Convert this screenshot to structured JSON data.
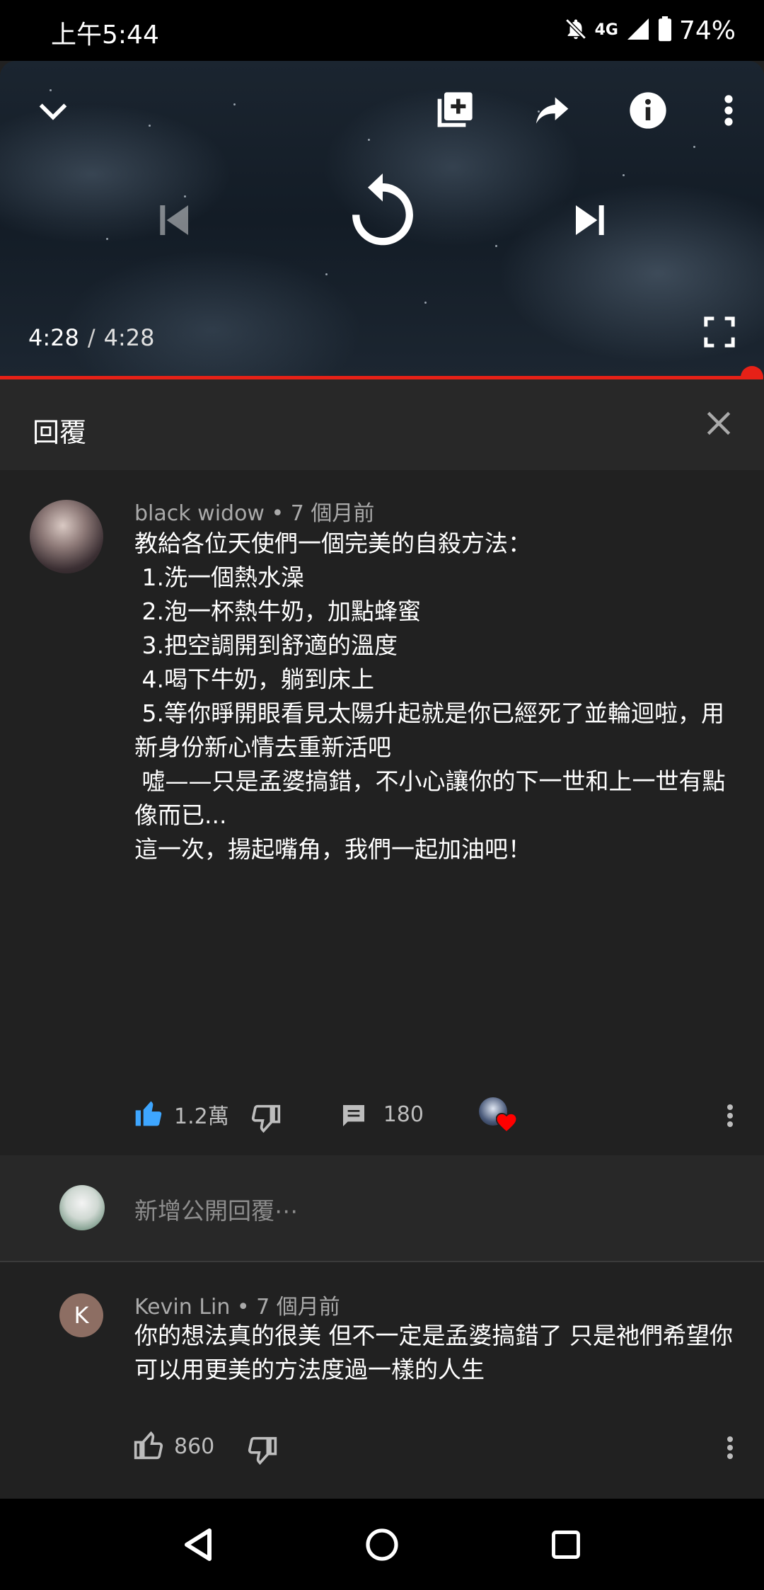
{
  "status_bar": {
    "time": "上午5:44",
    "network": "4G",
    "battery": "74%"
  },
  "player": {
    "current_time": "4:28",
    "separator": "/",
    "duration": "4:28",
    "progress_fraction": 1.0,
    "icons": [
      "chevron-down-icon",
      "add-to-playlist-icon",
      "share-icon",
      "info-icon",
      "more-vert-icon",
      "skip-previous-icon",
      "replay-icon",
      "skip-next-icon",
      "fullscreen-icon"
    ]
  },
  "replies_panel": {
    "title": "回覆"
  },
  "main_comment": {
    "author": "black widow",
    "dot": "•",
    "time": "7 個月前",
    "lines": [
      "教給各位天使們一個完美的自殺方法：",
      "",
      " 1.洗一個熱水澡",
      "",
      " 2.泡一杯熱牛奶，加點蜂蜜",
      "",
      " 3.把空調開到舒適的溫度",
      "",
      " 4.喝下牛奶，躺到床上",
      "",
      " 5.等你睜開眼看見太陽升起就是你已經死了並輪迴啦，用新身份新心情去重新活吧",
      "",
      " 噓——只是孟婆搞錯，不小心讓你的下一世和上一世有點像而已...",
      "這一次，揚起嘴角，我們一起加油吧！"
    ],
    "likes": "1.2萬",
    "replies": "180",
    "liked": true,
    "hearted": true
  },
  "add_reply": {
    "placeholder": "新增公開回覆⋯"
  },
  "reply_comment": {
    "avatar_letter": "K",
    "author": "Kevin Lin",
    "dot": "•",
    "time": "7 個月前",
    "text": "你的想法真的很美 但不一定是孟婆搞錯了 只是祂們希望你可以用更美的方法度過一樣的人生",
    "likes": "860"
  },
  "colors": {
    "accent_red": "#e62117",
    "like_blue": "#3ea6ff",
    "heart_red": "#ff0000"
  }
}
